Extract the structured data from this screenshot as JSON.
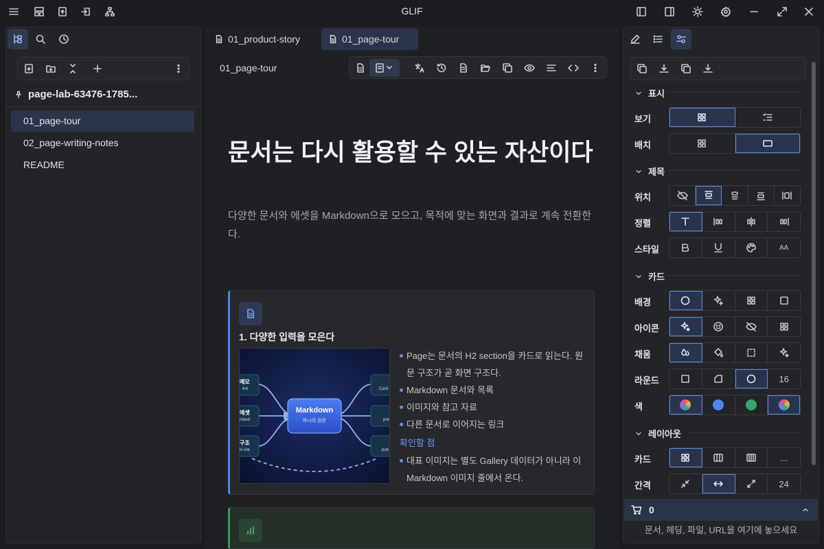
{
  "app": {
    "title": "GLIF"
  },
  "left": {
    "vault_name": "page-lab-63476-1785...",
    "files": [
      {
        "label": "01_page-tour"
      },
      {
        "label": "02_page-writing-notes"
      },
      {
        "label": "README"
      }
    ]
  },
  "tabs": [
    {
      "label": "01_product-story"
    },
    {
      "label": "01_page-tour"
    }
  ],
  "doc": {
    "breadcrumb": "01_page-tour",
    "title": "문서는 다시 활용할 수 있는 자산이다",
    "subtitle": "다양한 문서와 에셋을 Markdown으로 모으고, 목적에 맞는 화면과 결과로 계속 전환한다.",
    "card1": {
      "title": "1. 다양한 입력을 모은다",
      "bullets": [
        "Page는 문서의 H2 section을 카드로 읽는다. 원문 구조가 곧 화면 구조다.",
        "Markdown 문서와 목록",
        "이미지와 참고 자료",
        "다른 문서로 이어지는 링크"
      ],
      "check_heading": "확인할 점",
      "check_bullets": [
        "대표 이미지는 별도 Gallery 데이터가 아니라 이 Markdown 이미지 줄에서 온다."
      ],
      "diagram": {
        "center_title": "Markdown",
        "center_sub": "하나의 원문",
        "left_nodes": [
          {
            "t": "메모",
            "s": "· link"
          },
          {
            "t": "에셋",
            "s": "mbed"
          },
          {
            "t": "구조",
            "s": "ki link"
          }
        ],
        "right_nodes": [
          {
            "t": "",
            "s": "Card"
          },
          {
            "t": "",
            "s": "pre"
          },
          {
            "t": "",
            "s": "pub"
          }
        ]
      }
    }
  },
  "right": {
    "sections": {
      "display": "표시",
      "title": "제목",
      "card": "카드",
      "layout": "레이아웃"
    },
    "labels": {
      "view": "보기",
      "arrange": "배치",
      "position": "위치",
      "align": "정렬",
      "style": "스타일",
      "background": "배경",
      "icon": "아이콘",
      "fill": "채움",
      "round": "라운드",
      "color": "색",
      "cards": "카드",
      "gap": "간격"
    },
    "round_value": "16",
    "gap_value": "24",
    "more": "...",
    "size_glyph": "AA",
    "colors": [
      "#4f87f0",
      "#33a866"
    ],
    "cart_count": "0",
    "dropzone": "문서, 헤딩, 파일, URL을 여기에 놓으세요"
  }
}
